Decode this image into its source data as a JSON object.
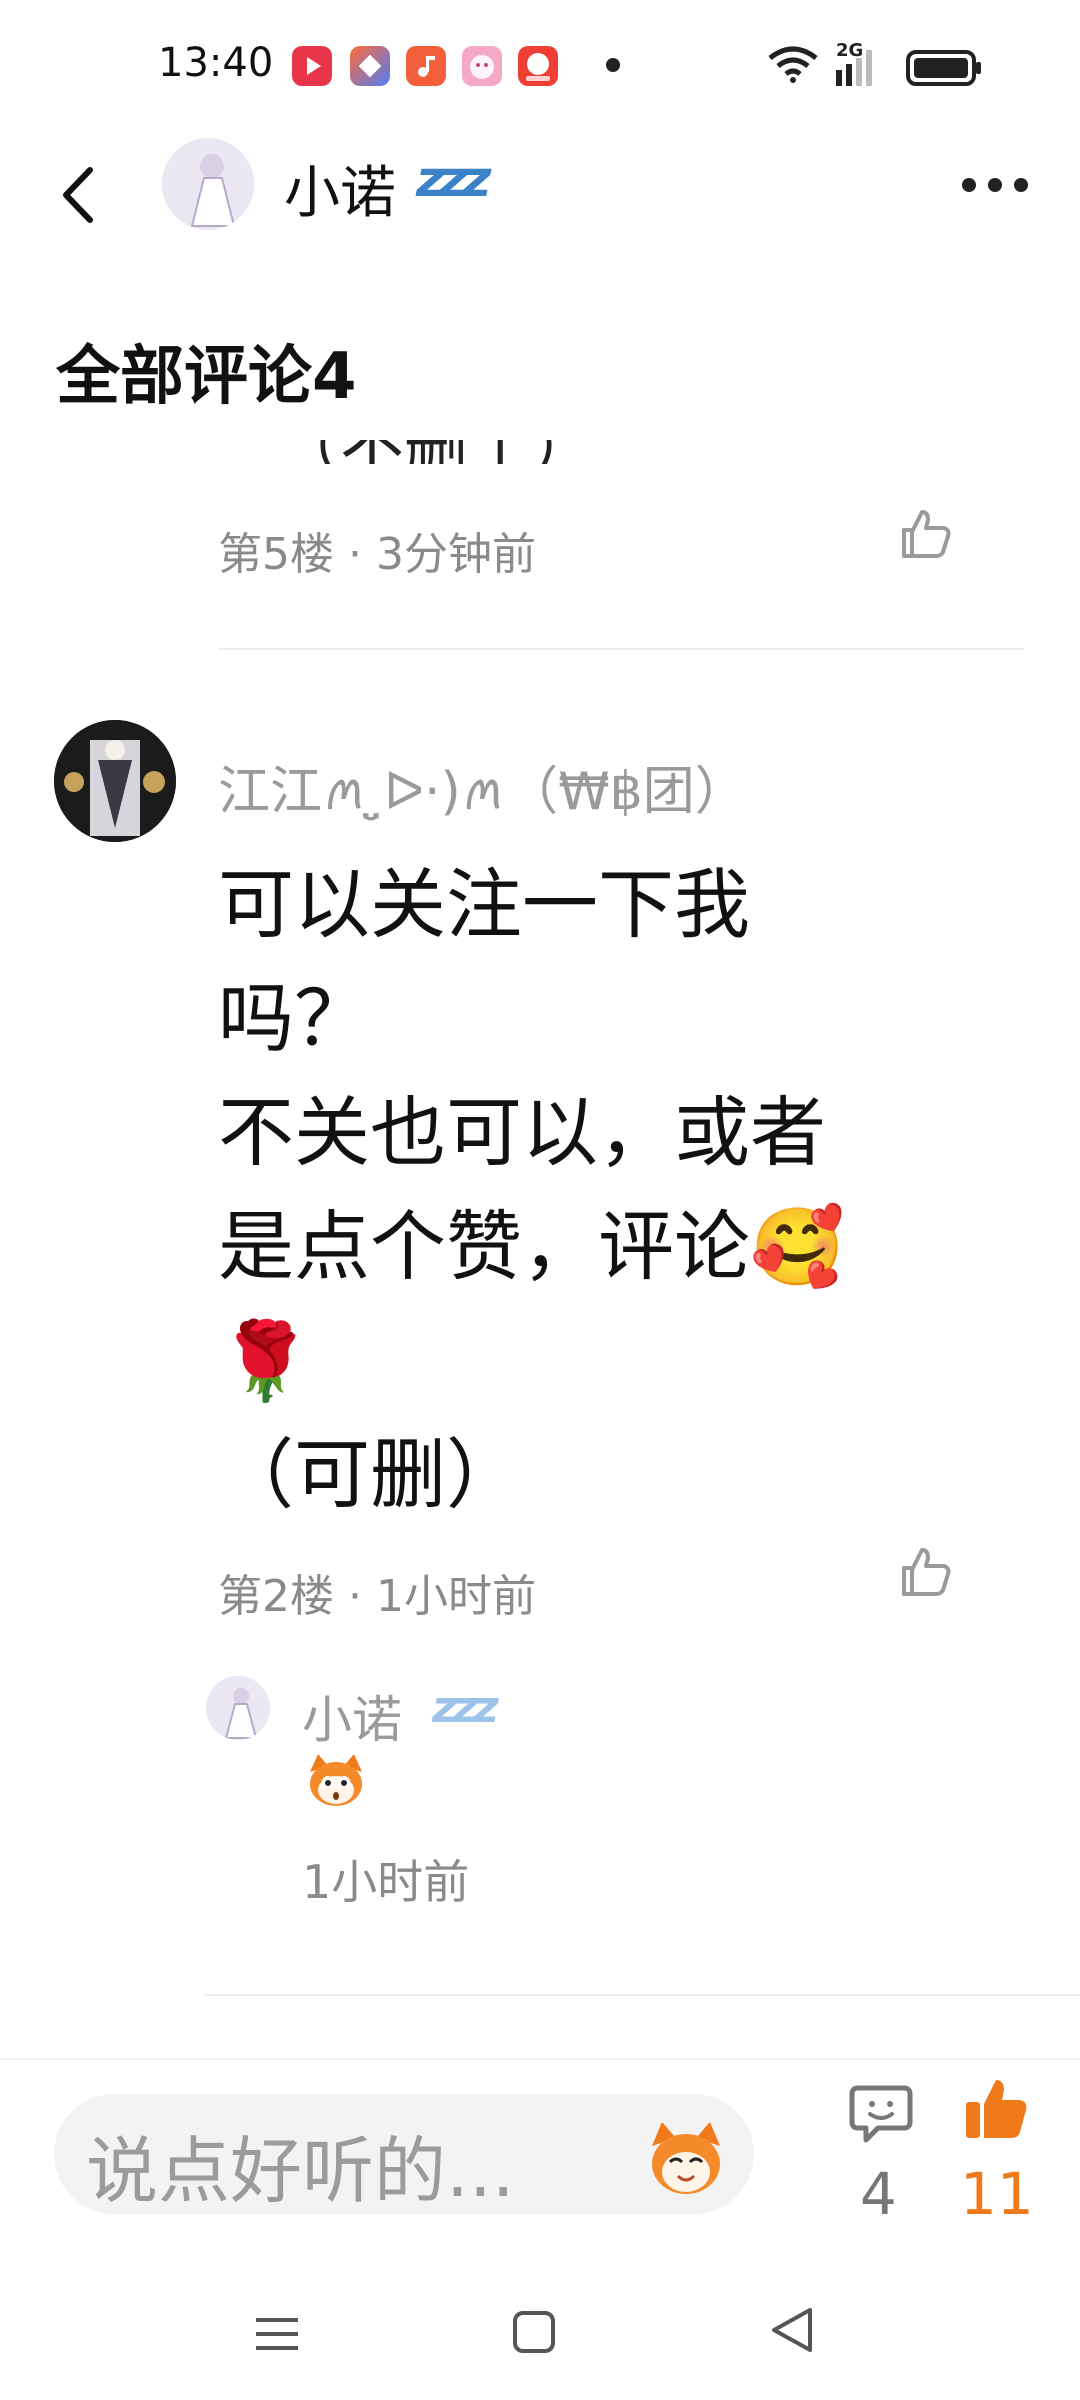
{
  "status_bar": {
    "time": "13:40",
    "network_label": "2G",
    "app_icons": [
      "video-app-icon",
      "mail-app-icon",
      "music-app-icon",
      "game-app-icon",
      "shopping-618-app-icon"
    ],
    "colors": {
      "video": "#e8354a",
      "mail": "#ff6b3a",
      "music": "#f25f3a",
      "game": "#f5a8c8",
      "shopping": "#ef3f35"
    }
  },
  "header": {
    "name": "小诺",
    "name_emoji": "zzz",
    "avatar_icon": "user-avatar"
  },
  "section": {
    "title": "全部评论4"
  },
  "comments": [
    {
      "cut_off_text": "（不删了）",
      "meta": "第5楼 · 3分钟前"
    },
    {
      "username": "江江ꪔ ̤̮ᐅ·)ꪔ（₩฿团）",
      "body": "可以关注一下我\n吗？\n不关也可以，或者\n是点个赞，评论🥰\n🌹\n（可删）",
      "meta": "第2楼 · 1小时前",
      "replies": [
        {
          "username": "小诺",
          "username_emoji": "zzz",
          "sticker_icon": "squirrel-sticker",
          "time": "1小时前"
        }
      ]
    }
  ],
  "bottom_bar": {
    "input_placeholder": "说点好听的...",
    "comment_count": "4",
    "like_count": "11",
    "accent_color": "#f07a1a"
  }
}
